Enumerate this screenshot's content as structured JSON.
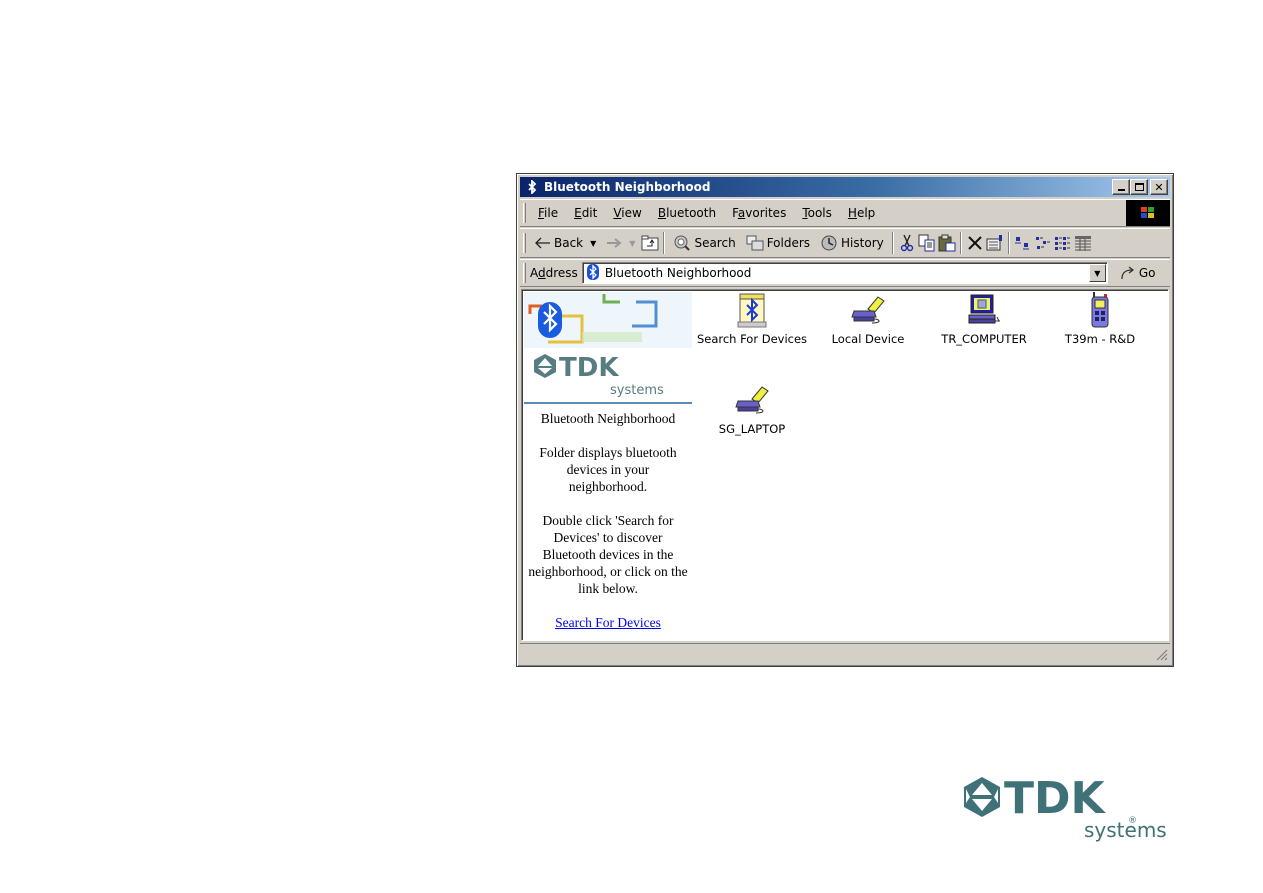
{
  "window": {
    "title": "Bluetooth Neighborhood",
    "controls": {
      "minimize": "_",
      "maximize": "□",
      "close": "✕"
    }
  },
  "menu": [
    {
      "label": "File",
      "accel": "F",
      "rest": "ile"
    },
    {
      "label": "Edit",
      "accel": "E",
      "rest": "dit"
    },
    {
      "label": "View",
      "accel": "V",
      "rest": "iew"
    },
    {
      "label": "Bluetooth",
      "accel": "B",
      "rest": "luetooth"
    },
    {
      "label": "Favorites",
      "accel": "a",
      "pre": "F",
      "rest": "vorites"
    },
    {
      "label": "Tools",
      "accel": "T",
      "rest": "ools"
    },
    {
      "label": "Help",
      "accel": "H",
      "rest": "elp"
    }
  ],
  "toolbar": {
    "back": "Back",
    "search": "Search",
    "folders": "Folders",
    "history": "History"
  },
  "address": {
    "label_pre": "A",
    "label_accel": "d",
    "label_rest": "dress",
    "value": "Bluetooth Neighborhood",
    "go": "Go"
  },
  "left_pane": {
    "brand": "TDK",
    "brand_sub": "systems",
    "heading": "Bluetooth Neighborhood",
    "para1": "Folder displays bluetooth devices in your neighborhood.",
    "para2": "Double click 'Search for Devices' to discover Bluetooth devices in the neighborhood, or click on the link below.",
    "link": "Search For Devices"
  },
  "devices": [
    {
      "name": "Search For Devices",
      "icon": "bluetooth-search-icon"
    },
    {
      "name": "Local Device",
      "icon": "laptop-icon"
    },
    {
      "name": "TR_COMPUTER",
      "icon": "desktop-computer-icon"
    },
    {
      "name": "T39m - R&D",
      "icon": "mobile-phone-icon"
    },
    {
      "name": "SG_LAPTOP",
      "icon": "laptop-icon"
    }
  ],
  "footer_logo": {
    "brand": "TDK",
    "sub": "systems",
    "color": "#3f7178"
  },
  "colors": {
    "title_start": "#0a246a",
    "title_end": "#a6caf0",
    "chrome": "#d4d0c8",
    "link": "#0000ee"
  }
}
